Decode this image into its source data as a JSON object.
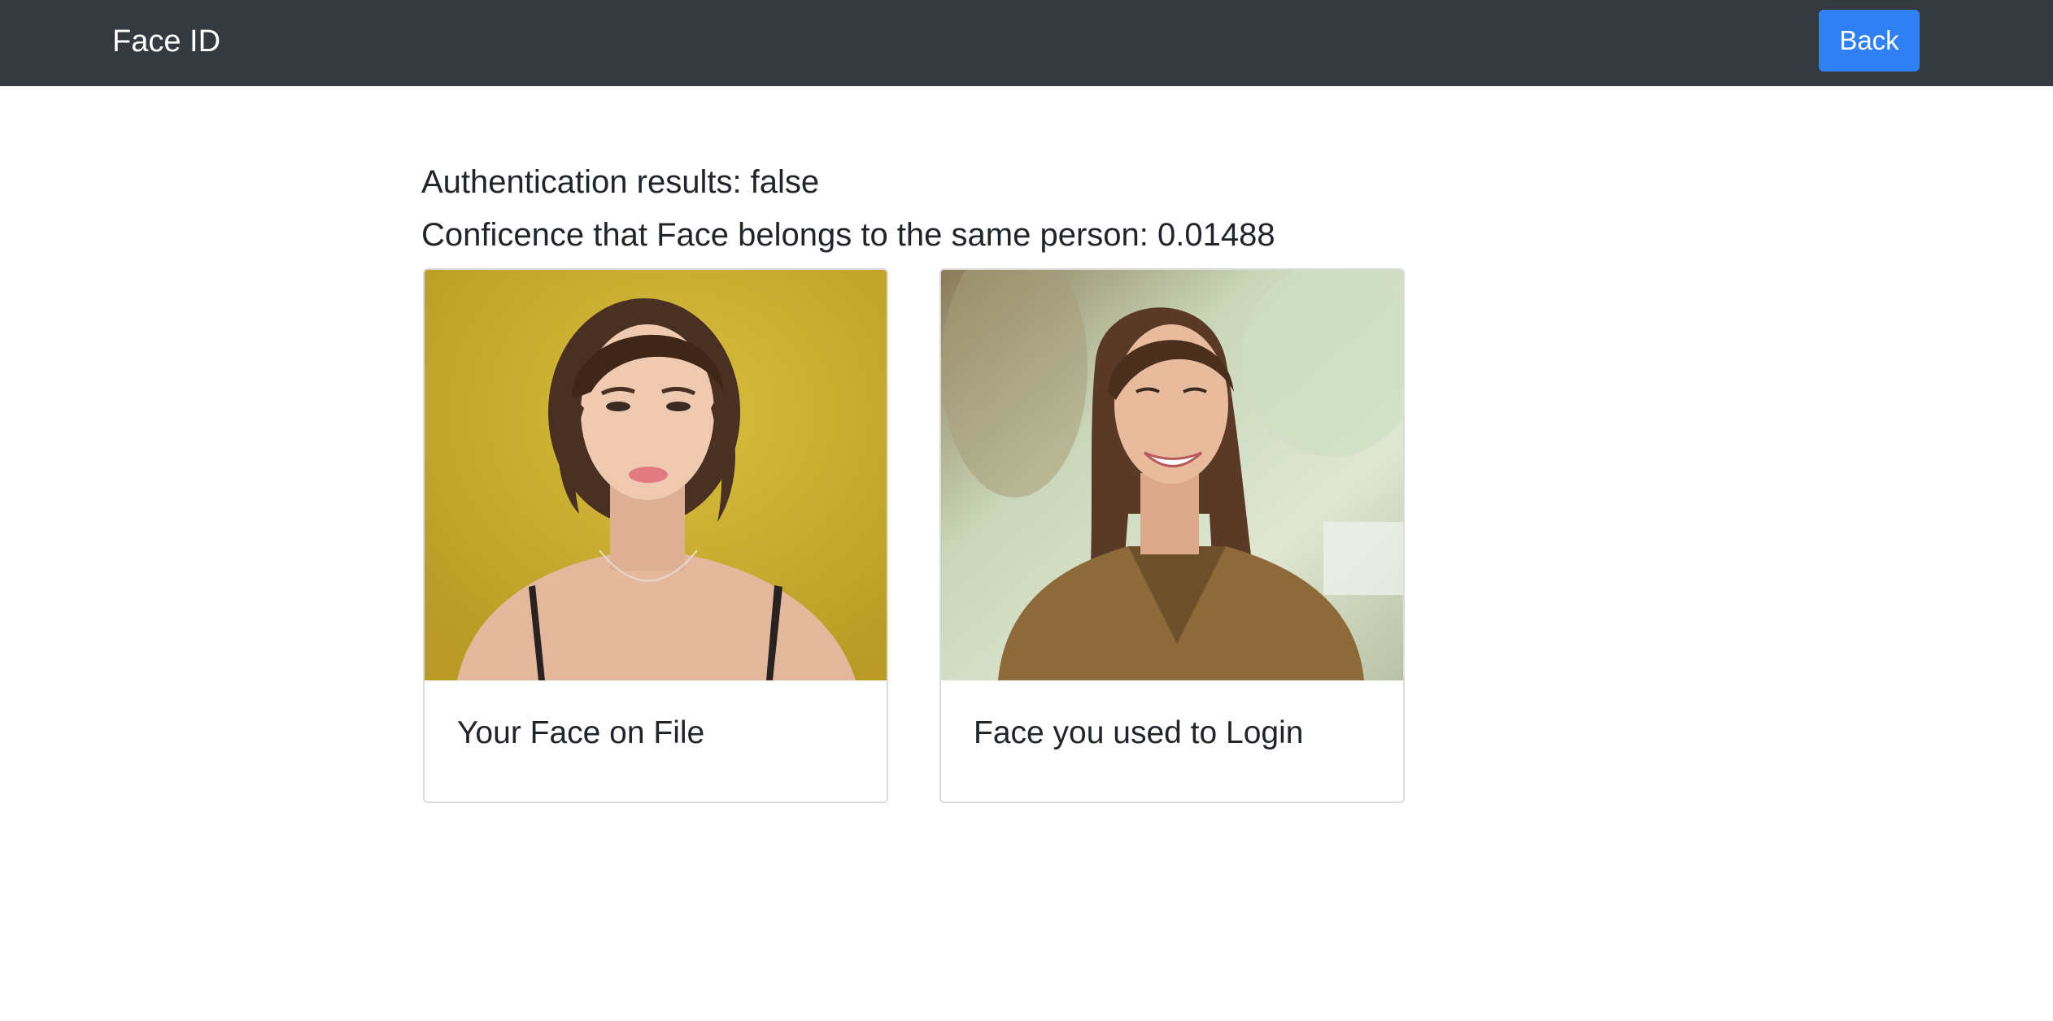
{
  "navbar": {
    "brand": "Face ID",
    "back_label": "Back"
  },
  "results": {
    "authentication": "Authentication results: false",
    "confidence": "Conficence that Face belongs to the same person: 0.01488"
  },
  "cards": [
    {
      "title": "Your Face on File"
    },
    {
      "title": "Face you used to Login"
    }
  ],
  "colors": {
    "navbar_bg": "#343a40",
    "button_primary": "#2f80f3",
    "text": "#212529"
  }
}
